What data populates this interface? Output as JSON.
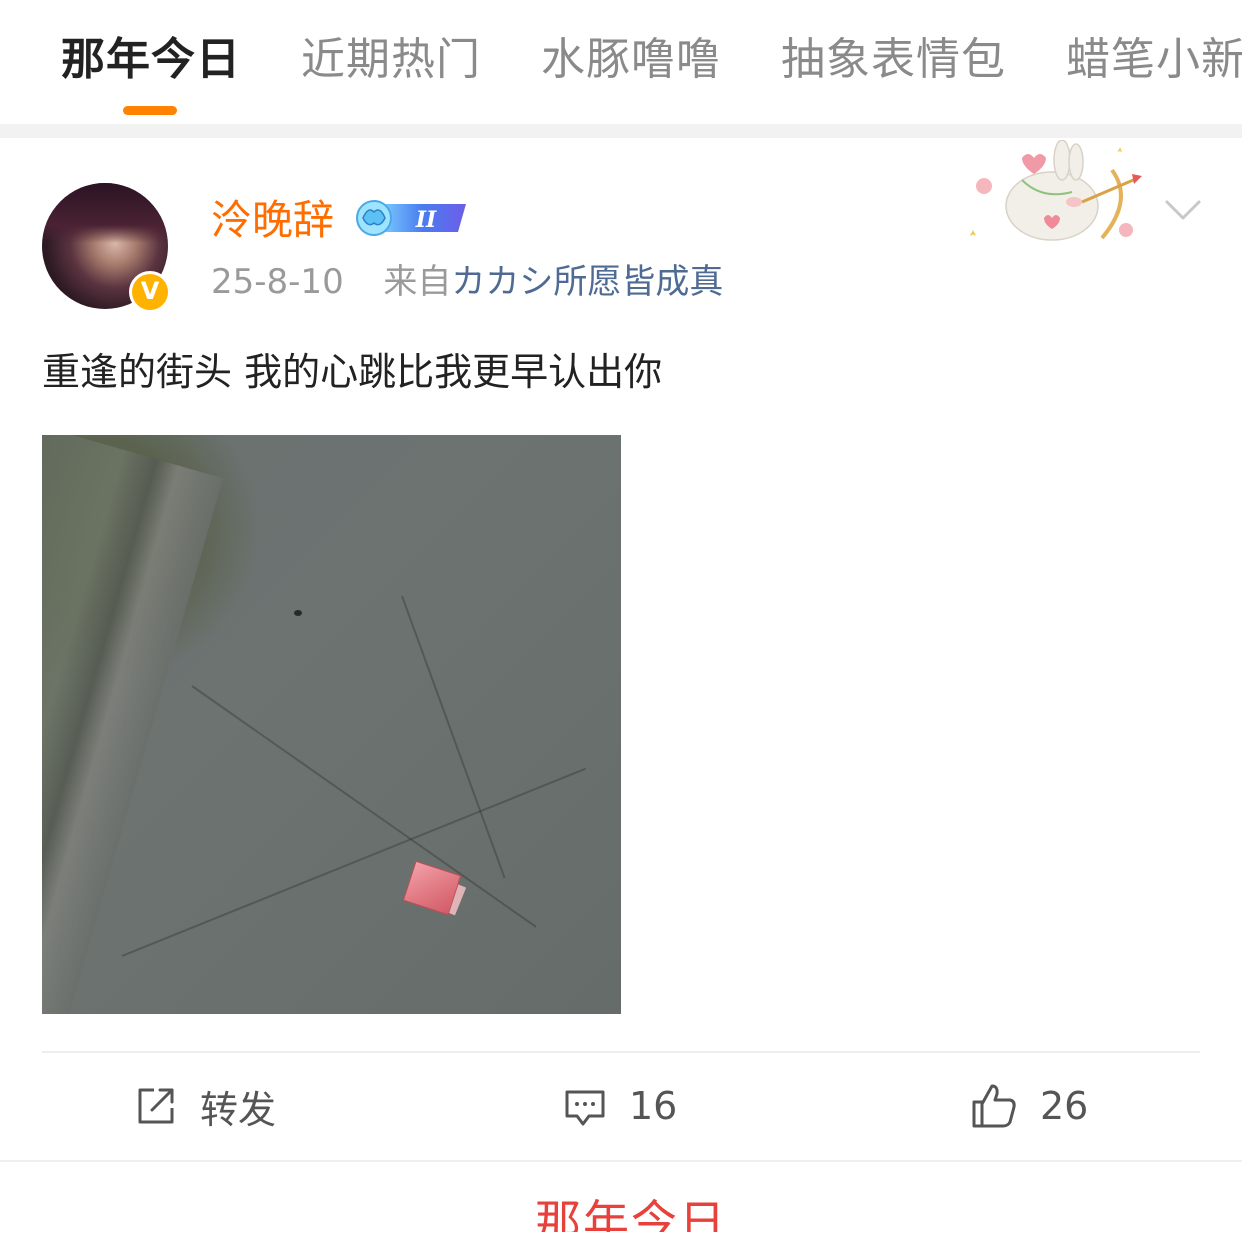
{
  "tabs": [
    {
      "label": "那年今日",
      "active": true
    },
    {
      "label": "近期热门",
      "active": false
    },
    {
      "label": "水豚噜噜",
      "active": false
    },
    {
      "label": "抽象表情包",
      "active": false
    },
    {
      "label": "蜡笔小新",
      "active": false
    }
  ],
  "accent_color": "#ff8200",
  "post": {
    "username": "泠晚辞",
    "username_color": "#ff6d00",
    "verified_mark": "V",
    "vip_level": "II",
    "date": "25-8-10",
    "from_prefix": "来自",
    "source": "カカシ所愿皆成真",
    "text": "重逢的街头 我的心跳比我更早认出你"
  },
  "actions": {
    "repost_label": "转发",
    "comments_count": "16",
    "likes_count": "26"
  },
  "bottom": {
    "title": "那年今日"
  }
}
